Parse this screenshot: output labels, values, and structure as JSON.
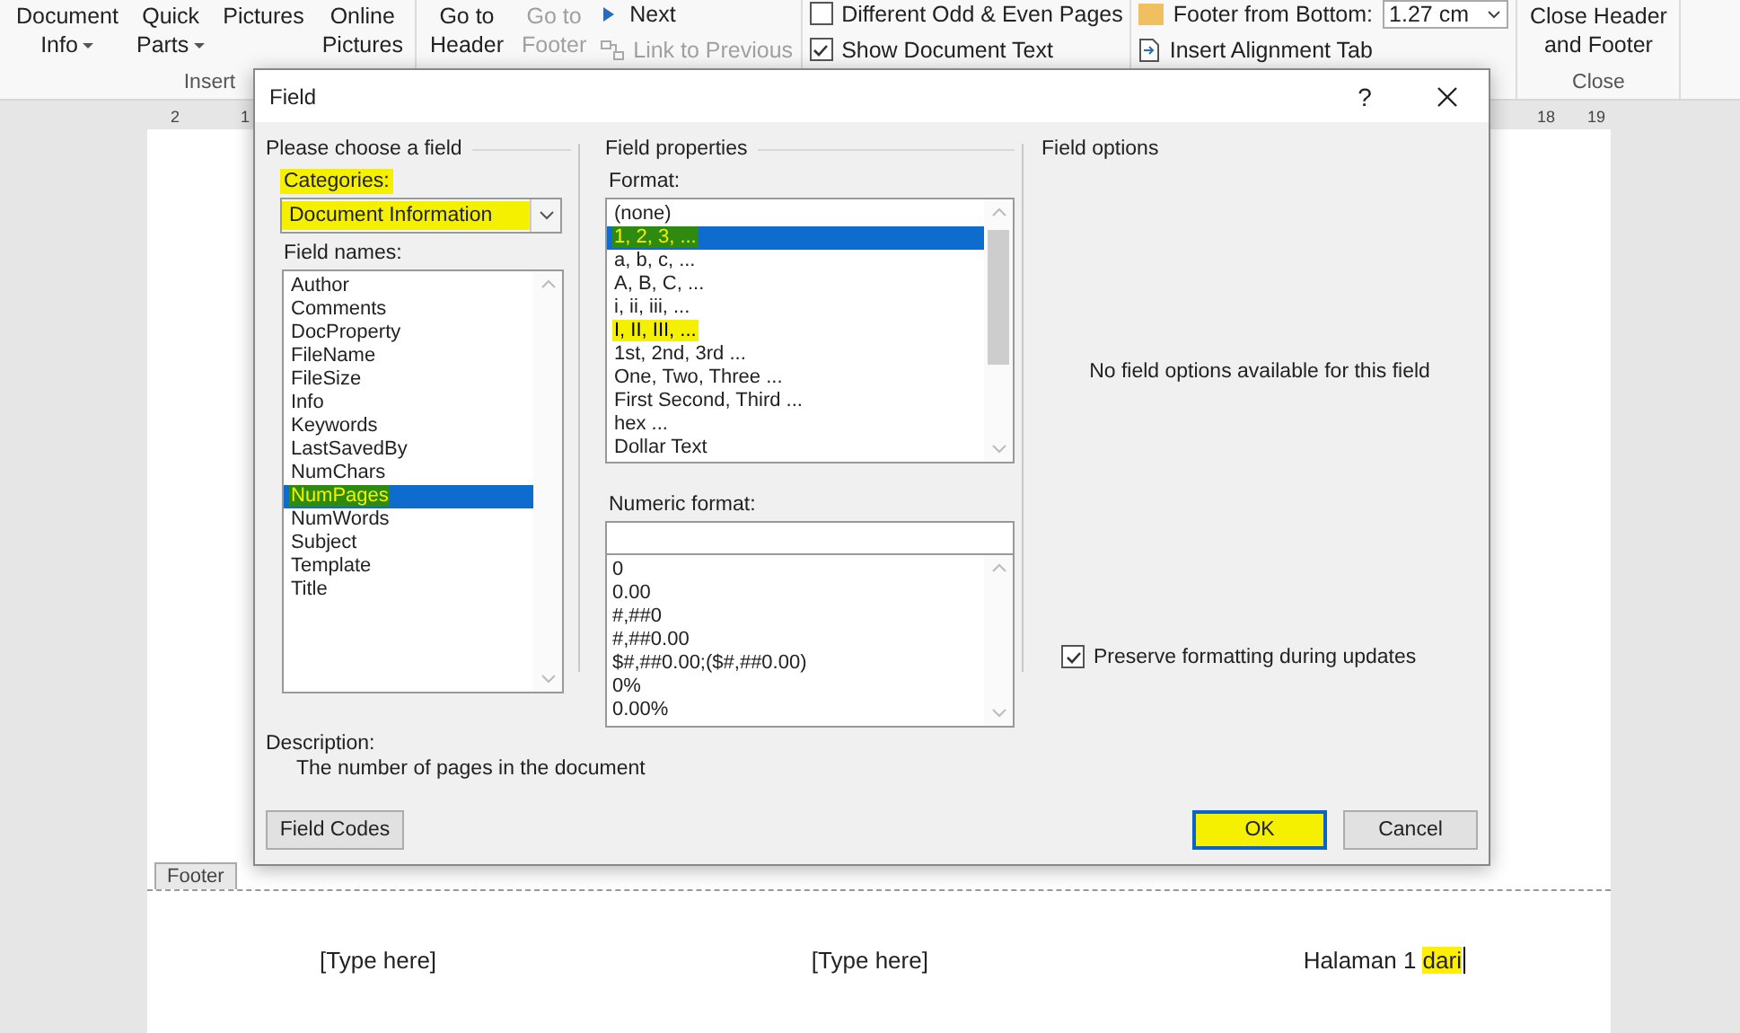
{
  "ribbon": {
    "groups": [
      {
        "label": "Insert",
        "items": [
          {
            "kind": "big",
            "lines": [
              "Document",
              "Info"
            ],
            "dropdown": true,
            "disabled": false
          },
          {
            "kind": "big",
            "lines": [
              "Quick",
              "Parts"
            ],
            "dropdown": true,
            "disabled": false
          },
          {
            "kind": "big",
            "lines": [
              "Pictures"
            ],
            "dropdown": false,
            "disabled": false
          },
          {
            "kind": "big",
            "lines": [
              "Online",
              "Pictures"
            ],
            "dropdown": false,
            "disabled": false
          }
        ]
      },
      {
        "items": [
          {
            "kind": "big",
            "lines": [
              "Go to",
              "Header"
            ],
            "dropdown": false,
            "disabled": false
          },
          {
            "kind": "big",
            "lines": [
              "Go to",
              "Footer"
            ],
            "dropdown": false,
            "disabled": true
          },
          {
            "kind": "stack",
            "rows": [
              {
                "kind": "button",
                "label": "Next",
                "disabled": false
              },
              {
                "kind": "button",
                "label": "Link to Previous",
                "disabled": true
              }
            ]
          }
        ]
      },
      {
        "items": [
          {
            "kind": "stack",
            "rows": [
              {
                "kind": "checkbox",
                "label": "Different Odd & Even Pages",
                "checked": false
              },
              {
                "kind": "checkbox",
                "label": "Show Document Text",
                "checked": true
              }
            ]
          }
        ]
      },
      {
        "items": [
          {
            "kind": "stack",
            "rows": [
              {
                "kind": "spin",
                "label": "Footer from Bottom:",
                "value": "1.27 cm"
              },
              {
                "kind": "button",
                "label": "Insert Alignment Tab",
                "disabled": false
              }
            ]
          }
        ]
      },
      {
        "label": "Close",
        "items": [
          {
            "kind": "big",
            "lines": [
              "Close Header",
              "and Footer"
            ],
            "dropdown": false,
            "disabled": false
          }
        ]
      }
    ]
  },
  "ruler": {
    "left_labels": [
      "2",
      "1"
    ],
    "right_labels": [
      "18",
      "19"
    ]
  },
  "dialog": {
    "title": "Field",
    "help": "?",
    "choose": {
      "heading": "Please choose a field",
      "categories_label": "Categories:",
      "categories_label_highlighted": true,
      "category_value": "Document Information",
      "category_highlighted": true,
      "field_names_label": "Field names:",
      "field_names": [
        {
          "label": "Author",
          "selected": false,
          "highlighted": false
        },
        {
          "label": "Comments",
          "selected": false,
          "highlighted": false
        },
        {
          "label": "DocProperty",
          "selected": false,
          "highlighted": false
        },
        {
          "label": "FileName",
          "selected": false,
          "highlighted": false
        },
        {
          "label": "FileSize",
          "selected": false,
          "highlighted": false
        },
        {
          "label": "Info",
          "selected": false,
          "highlighted": false
        },
        {
          "label": "Keywords",
          "selected": false,
          "highlighted": false
        },
        {
          "label": "LastSavedBy",
          "selected": false,
          "highlighted": false
        },
        {
          "label": "NumChars",
          "selected": false,
          "highlighted": false
        },
        {
          "label": "NumPages",
          "selected": true,
          "highlighted": true
        },
        {
          "label": "NumWords",
          "selected": false,
          "highlighted": false
        },
        {
          "label": "Subject",
          "selected": false,
          "highlighted": false
        },
        {
          "label": "Template",
          "selected": false,
          "highlighted": false
        },
        {
          "label": "Title",
          "selected": false,
          "highlighted": false
        }
      ],
      "description_label": "Description:",
      "description": "The number of pages in the document"
    },
    "properties": {
      "heading": "Field properties",
      "format_label": "Format:",
      "formats": [
        {
          "label": "(none)",
          "selected": false,
          "highlighted": false
        },
        {
          "label": "1, 2, 3, ...",
          "selected": true,
          "highlighted": true
        },
        {
          "label": "a, b, c, ...",
          "selected": false,
          "highlighted": false
        },
        {
          "label": "A, B, C, ...",
          "selected": false,
          "highlighted": false
        },
        {
          "label": "i, ii, iii, ...",
          "selected": false,
          "highlighted": false
        },
        {
          "label": "I, II, III, ...",
          "selected": false,
          "highlighted": true
        },
        {
          "label": "1st, 2nd, 3rd ...",
          "selected": false,
          "highlighted": false
        },
        {
          "label": "One, Two, Three ...",
          "selected": false,
          "highlighted": false
        },
        {
          "label": "First Second, Third ...",
          "selected": false,
          "highlighted": false
        },
        {
          "label": "hex ...",
          "selected": false,
          "highlighted": false
        },
        {
          "label": "Dollar Text",
          "selected": false,
          "highlighted": false
        }
      ],
      "numeric_label": "Numeric format:",
      "numeric_formats": [
        "0",
        "0.00",
        "#,##0",
        "#,##0.00",
        "$#,##0.00;($#,##0.00)",
        "0%",
        "0.00%"
      ]
    },
    "options": {
      "heading": "Field options",
      "message": "No field options available for this field",
      "preserve_label": "Preserve formatting during updates",
      "preserve_checked": true
    },
    "buttons": [
      {
        "kind": "field_codes",
        "label": "Field Codes",
        "default": false,
        "highlighted": false
      },
      {
        "kind": "ok",
        "label": "OK",
        "default": true,
        "highlighted": true
      },
      {
        "kind": "cancel",
        "label": "Cancel",
        "default": false,
        "highlighted": false
      }
    ]
  },
  "footer": {
    "tab": "Footer",
    "left": "[Type here]",
    "center": "[Type here]",
    "right": [
      {
        "text": "Halaman 1 ",
        "highlighted": false
      },
      {
        "text": "dari",
        "highlighted": true
      }
    ]
  }
}
